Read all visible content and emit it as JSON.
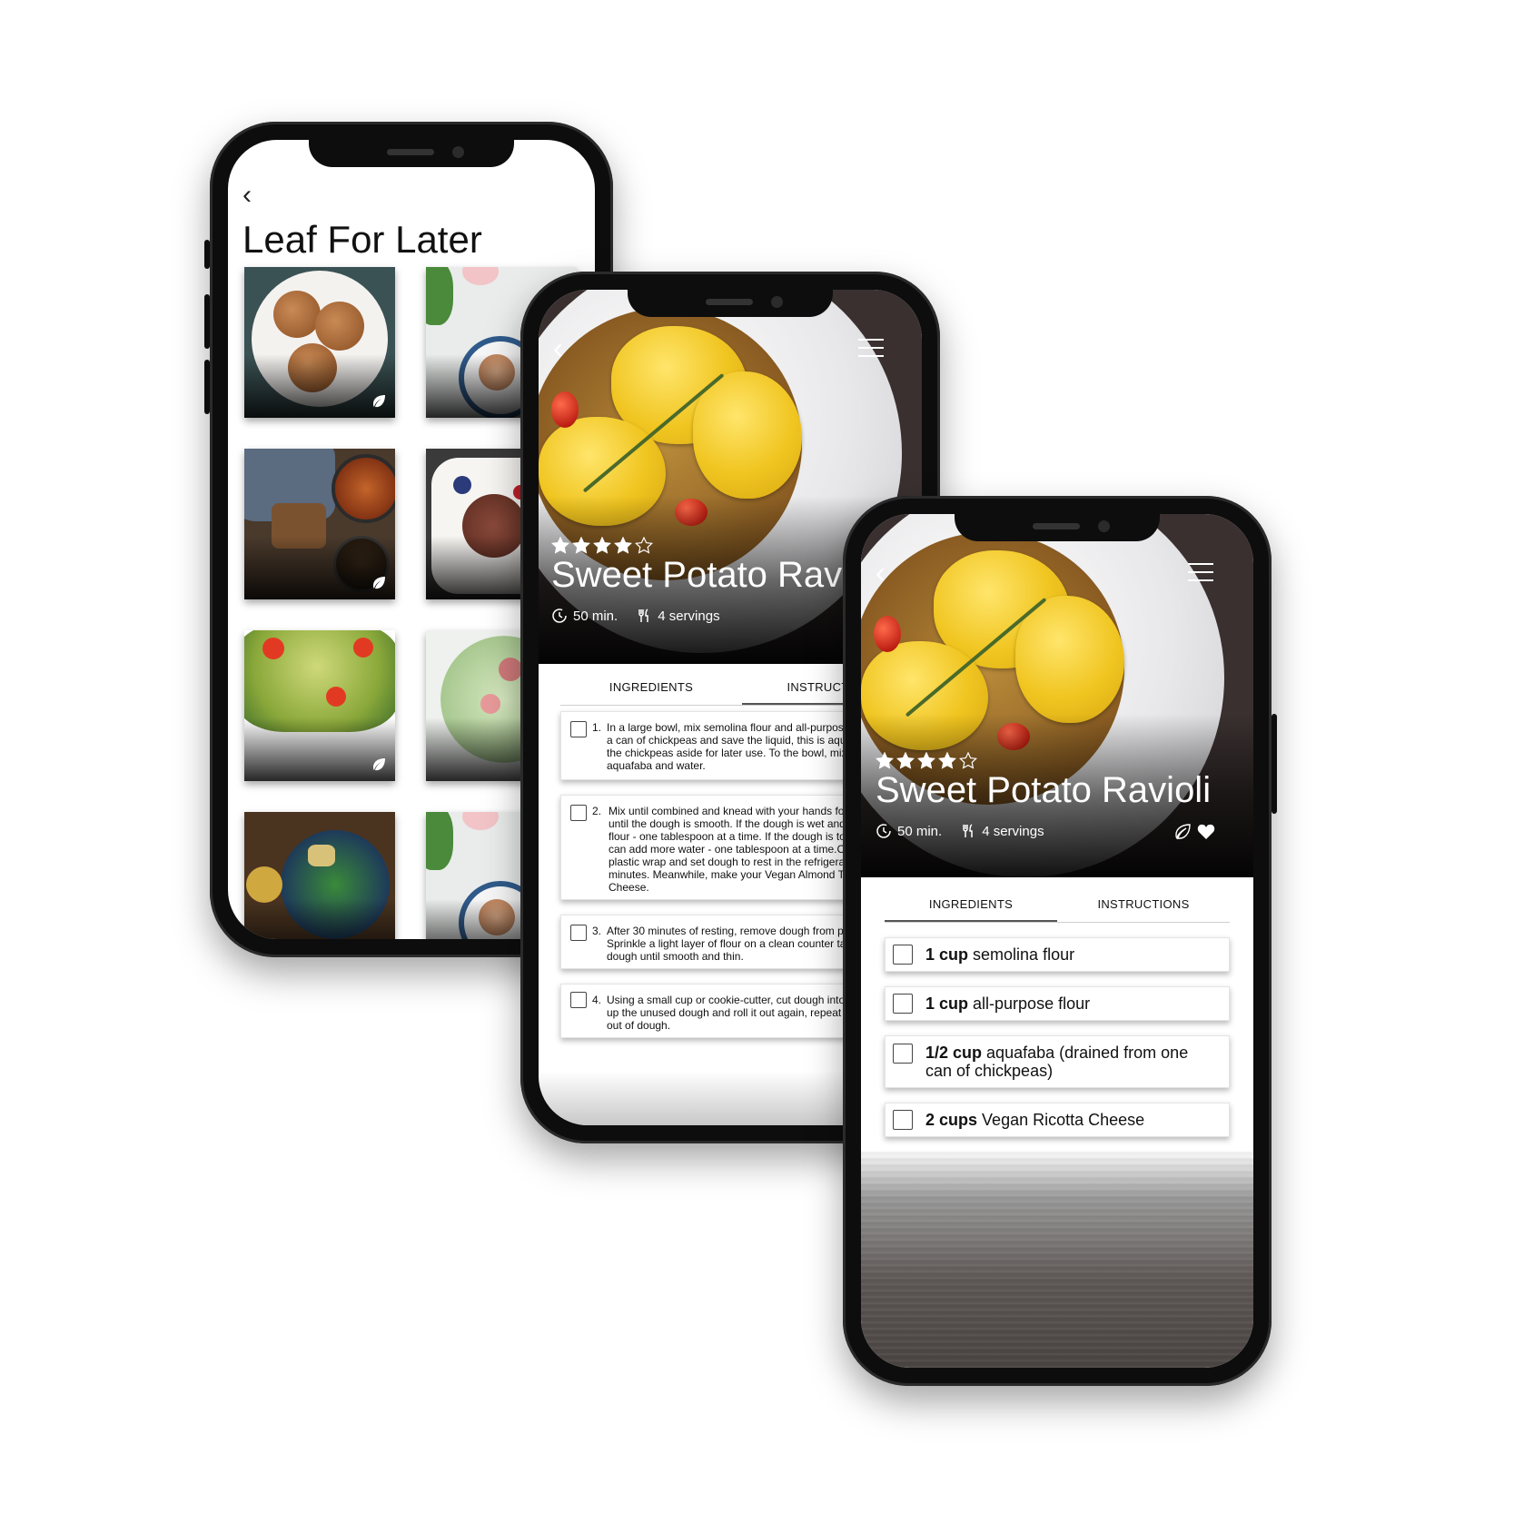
{
  "saved_screen": {
    "title": "Leaf For Later"
  },
  "recipe": {
    "title": "Sweet Potato Ravioli",
    "rating": 4,
    "rating_max": 5,
    "time": "50 min.",
    "servings": "4 servings"
  },
  "tabs": {
    "ingredients": "INGREDIENTS",
    "instructions": "INSTRUCTIONS"
  },
  "instructions": [
    {
      "num": "1.",
      "text": "In a large bowl, mix semolina flour and all-purpose flour. Drain a can of chickpeas and save the liquid, this is aquafaba. Set the chickpeas aside for later use. To the bowl, mix in aquafaba and water."
    },
    {
      "num": "2.",
      "text": "Mix until combined and knead with your hands for a minute until the dough is smooth. If the dough is wet and sticky, add flour - one tablespoon at a time. If the dough is too dry, you can add more water - one tablespoon at a time.Cover in plastic wrap and set dough to rest in the refrigerator for 30 minutes. Meanwhile, make your Vegan Almond Tofu Ricotta Cheese."
    },
    {
      "num": "3.",
      "text": "After 30 minutes of resting, remove dough from plastic wrap. Sprinkle a light layer of flour on a clean counter table. Roll dough until smooth and thin."
    },
    {
      "num": "4.",
      "text": "Using a small cup or cookie-cutter, cut dough into circles. Ball up the unused dough and roll it out again, repeat until you run out of dough."
    }
  ],
  "ingredients": [
    {
      "amount": "1 cup",
      "name": "semolina flour"
    },
    {
      "amount": "1 cup",
      "name": "all-purpose flour"
    },
    {
      "amount": "1/2 cup",
      "name": "aquafaba (drained from one",
      "name_line2": "can of chickpeas)"
    },
    {
      "amount": "2 cups",
      "name": "Vegan Ricotta Cheese"
    }
  ],
  "colors": {
    "frame": "#0d0d0d",
    "accent_gold": "#f0c520",
    "tab_underline": "#555555"
  }
}
